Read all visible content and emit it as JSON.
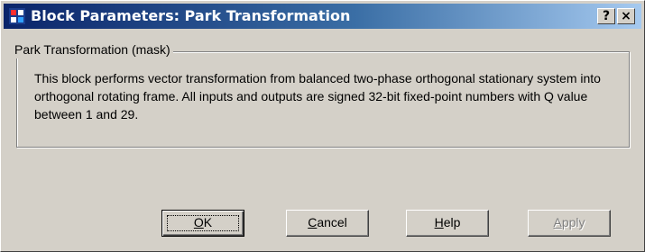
{
  "window": {
    "title": "Block Parameters: Park Transformation",
    "help_button": "?",
    "close_button": "×"
  },
  "group": {
    "legend": "Park Transformation (mask)",
    "description": "This block performs vector transformation from balanced two-phase orthogonal stationary system into orthogonal rotating frame. All inputs and outputs are signed 32-bit fixed-point numbers with Q value between 1 and 29."
  },
  "buttons": {
    "ok": {
      "mnemonic": "O",
      "rest": "K"
    },
    "cancel": {
      "mnemonic": "C",
      "rest": "ancel"
    },
    "help": {
      "mnemonic": "H",
      "rest": "elp"
    },
    "apply": {
      "mnemonic": "A",
      "rest": "pply",
      "enabled": false
    }
  },
  "colors": {
    "titlebar_start": "#0a246a",
    "titlebar_end": "#a6caf0",
    "face": "#d4d0c8"
  }
}
